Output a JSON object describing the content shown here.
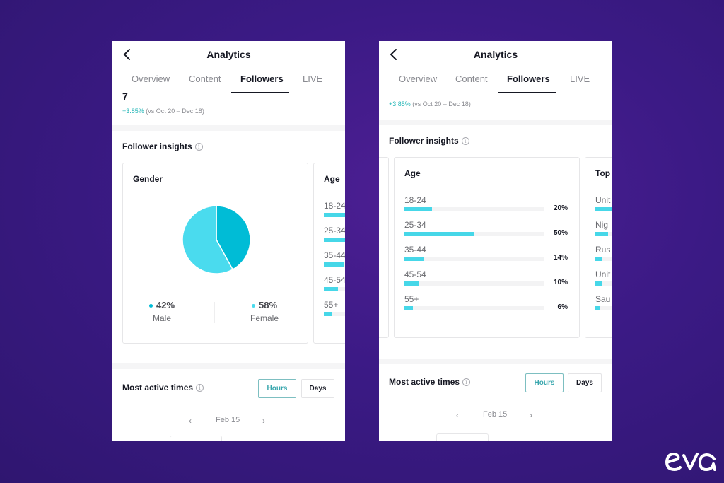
{
  "colors": {
    "background": "#3b1a85",
    "accent_cyan": "#46d7e8",
    "pie_male": "#00bcd6",
    "pie_female": "#4adbee",
    "positive": "#20b5b6",
    "active_button": "#3aa7ae"
  },
  "screens": [
    {
      "header": {
        "title": "Analytics",
        "back_icon": "chevron-left-icon"
      },
      "tabs": [
        {
          "label": "Overview",
          "active": false
        },
        {
          "label": "Content",
          "active": false
        },
        {
          "label": "Followers",
          "active": true
        },
        {
          "label": "LIVE",
          "active": false
        }
      ],
      "followers_total": "7",
      "change": {
        "value": "+3.85%",
        "period": " (vs Oct 20 – Dec 18)"
      },
      "insights": {
        "title": "Follower insights",
        "gender": {
          "title": "Gender",
          "segments": [
            {
              "label": "Male",
              "percent": 42,
              "display": "42%"
            },
            {
              "label": "Female",
              "percent": 58,
              "display": "58%"
            }
          ]
        },
        "age_partial": {
          "title": "Age",
          "rows": [
            {
              "label": "18-24",
              "percent": 20
            },
            {
              "label": "25-34",
              "percent": 50
            },
            {
              "label": "35-44",
              "percent": 14
            },
            {
              "label": "45-54",
              "percent": 10
            },
            {
              "label": "55+",
              "percent": 6
            }
          ]
        }
      },
      "active_times": {
        "title": "Most active times",
        "buttons": [
          {
            "label": "Hours",
            "active": true
          },
          {
            "label": "Days",
            "active": false
          }
        ],
        "date": "Feb 15"
      }
    },
    {
      "header": {
        "title": "Analytics",
        "back_icon": "chevron-left-icon"
      },
      "tabs": [
        {
          "label": "Overview",
          "active": false
        },
        {
          "label": "Content",
          "active": false
        },
        {
          "label": "Followers",
          "active": true
        },
        {
          "label": "LIVE",
          "active": false
        }
      ],
      "change": {
        "value": "+3.85%",
        "period": " (vs Oct 20 – Dec 18)"
      },
      "insights": {
        "title": "Follower insights",
        "age": {
          "title": "Age",
          "rows": [
            {
              "label": "18-24",
              "percent": 20,
              "display": "20%"
            },
            {
              "label": "25-34",
              "percent": 50,
              "display": "50%"
            },
            {
              "label": "35-44",
              "percent": 14,
              "display": "14%"
            },
            {
              "label": "45-54",
              "percent": 10,
              "display": "10%"
            },
            {
              "label": "55+",
              "percent": 6,
              "display": "6%"
            }
          ]
        },
        "top_locations_partial": {
          "title": "Top",
          "rows": [
            {
              "label": "Unit",
              "percent": 60
            },
            {
              "label": "Nig",
              "percent": 9
            },
            {
              "label": "Rus",
              "percent": 5
            },
            {
              "label": "Unit",
              "percent": 5
            },
            {
              "label": "Sau",
              "percent": 3
            }
          ]
        }
      },
      "active_times": {
        "title": "Most active times",
        "buttons": [
          {
            "label": "Hours",
            "active": true
          },
          {
            "label": "Days",
            "active": false
          }
        ],
        "date": "Feb 15"
      }
    }
  ],
  "brand": {
    "logo_text": "eva"
  }
}
